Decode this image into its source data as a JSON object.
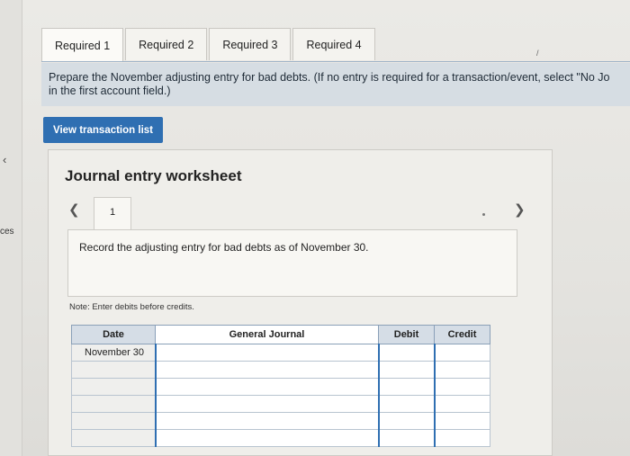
{
  "tabs": [
    {
      "label": "Required 1"
    },
    {
      "label": "Required 2"
    },
    {
      "label": "Required 3"
    },
    {
      "label": "Required 4"
    }
  ],
  "left_sidebar": {
    "chevron": "‹",
    "label": "ces"
  },
  "instruction": {
    "line1": "Prepare the November adjusting entry for bad debts. (If no entry is required for a transaction/event, select \"No Jo",
    "line2": "in the first account field.)"
  },
  "view_button_label": "View transaction list",
  "worksheet": {
    "title": "Journal entry worksheet",
    "page_number": "1",
    "record_text": "Record the adjusting entry for bad debts as of November 30.",
    "note": "Note: Enter debits before credits.",
    "columns": [
      "Date",
      "General Journal",
      "Debit",
      "Credit"
    ],
    "rows": [
      {
        "date": "November 30"
      },
      {
        "date": ""
      },
      {
        "date": ""
      },
      {
        "date": ""
      },
      {
        "date": ""
      },
      {
        "date": ""
      }
    ]
  },
  "colors": {
    "accent": "#2f6fb2",
    "instruction_bg": "#d6dde3",
    "header_bg": "#d5dde6"
  },
  "icons": [
    "chevron-left-icon",
    "chevron-right-icon"
  ]
}
